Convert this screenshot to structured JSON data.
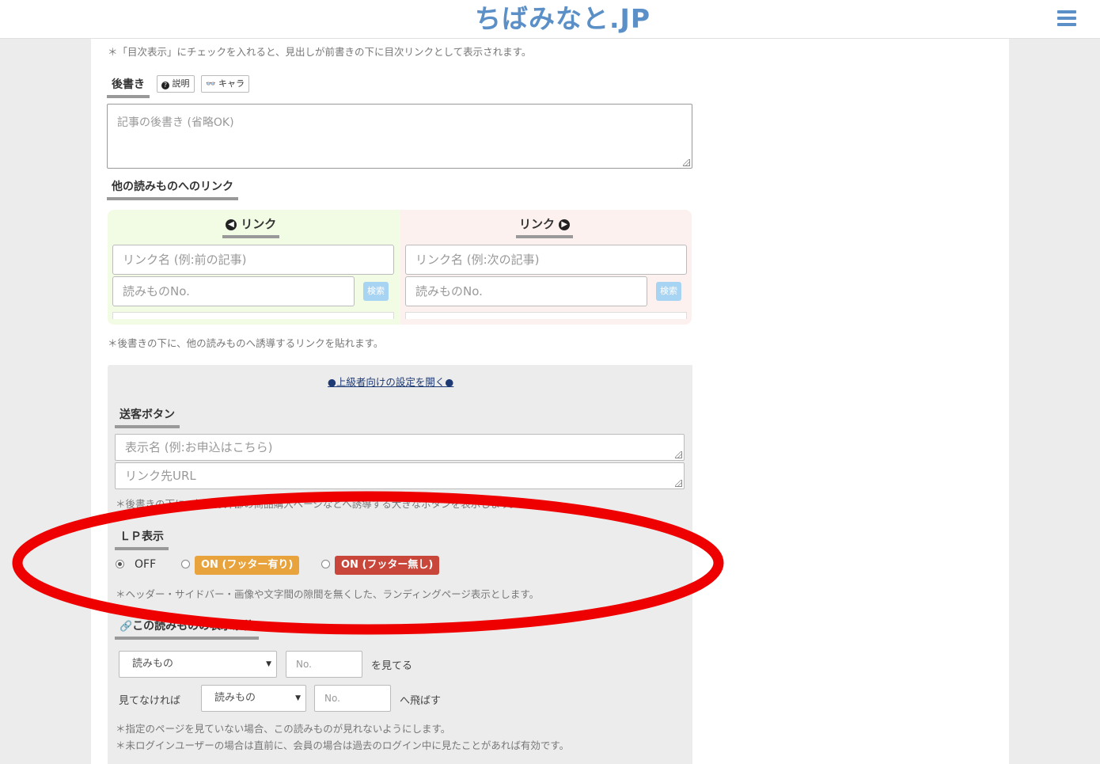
{
  "header": {
    "logo_text": "ちばみなと.JP",
    "menu_icon": "hamburger-icon"
  },
  "toc_note": "＊「目次表示」にチェックを入れると、見出しが前書きの下に目次リンクとして表示されます。",
  "afterword": {
    "heading": "後書き",
    "explain_button": "説明",
    "explain_icon": "question-circle-icon",
    "chara_button": "キャラ",
    "chara_icon": "glasses-icon",
    "placeholder": "記事の後書き (省略OK)"
  },
  "other_links": {
    "heading": "他の読みものへのリンク",
    "left": {
      "heading": "リンク",
      "name_placeholder": "リンク名 (例:前の記事)",
      "number_placeholder": "読みものNo.",
      "search_button": "検索"
    },
    "right": {
      "heading": "リンク",
      "name_placeholder": "リンク名 (例:次の記事)",
      "number_placeholder": "読みものNo.",
      "search_button": "検索"
    },
    "note": "＊後書きの下に、他の読みものへ誘導するリンクを貼れます。"
  },
  "advanced": {
    "toggle_link": "●上級者向けの設定を開く●",
    "cta": {
      "heading": "送客ボタン",
      "label_placeholder": "表示名 (例:お申込はこちら)",
      "url_placeholder": "リンク先URL",
      "note": "＊後書きの下に、例えば外部の商品購入ページなどへ誘導する大きなボタンを表示します。"
    },
    "lp": {
      "heading": "ＬＰ表示",
      "options": [
        {
          "label": "OFF",
          "checked": true
        },
        {
          "label": "ON (フッター有り)",
          "checked": false,
          "color": "#e8a33d"
        },
        {
          "label": "ON (フッター無し)",
          "checked": false,
          "color": "#c9473a"
        }
      ],
      "note": "＊ヘッダー・サイドバー・画像や文字間の隙間を無くした、ランディングページ表示とします。"
    },
    "condition": {
      "heading": "この読みものの表示条件",
      "heading_icon": "link-icon",
      "row1_select": "読みもの",
      "row1_number_placeholder": "No.",
      "row1_suffix": "を見てる",
      "row2_prefix": "見てなければ",
      "row2_select": "読みもの",
      "row2_number_placeholder": "No.",
      "row2_suffix": "へ飛ばす",
      "note1": "＊指定のページを見ていない場合、この読みものが見れないようにします。",
      "note2": "＊未ログインユーザーの場合は直前に、会員の場合は過去のログイン中に見たことがあれば有効です。"
    }
  },
  "colors": {
    "accent_blue": "#5b8fc7",
    "annotation_red": "#ee0000",
    "footer_on": "#e8a33d",
    "footer_off": "#c9473a"
  }
}
